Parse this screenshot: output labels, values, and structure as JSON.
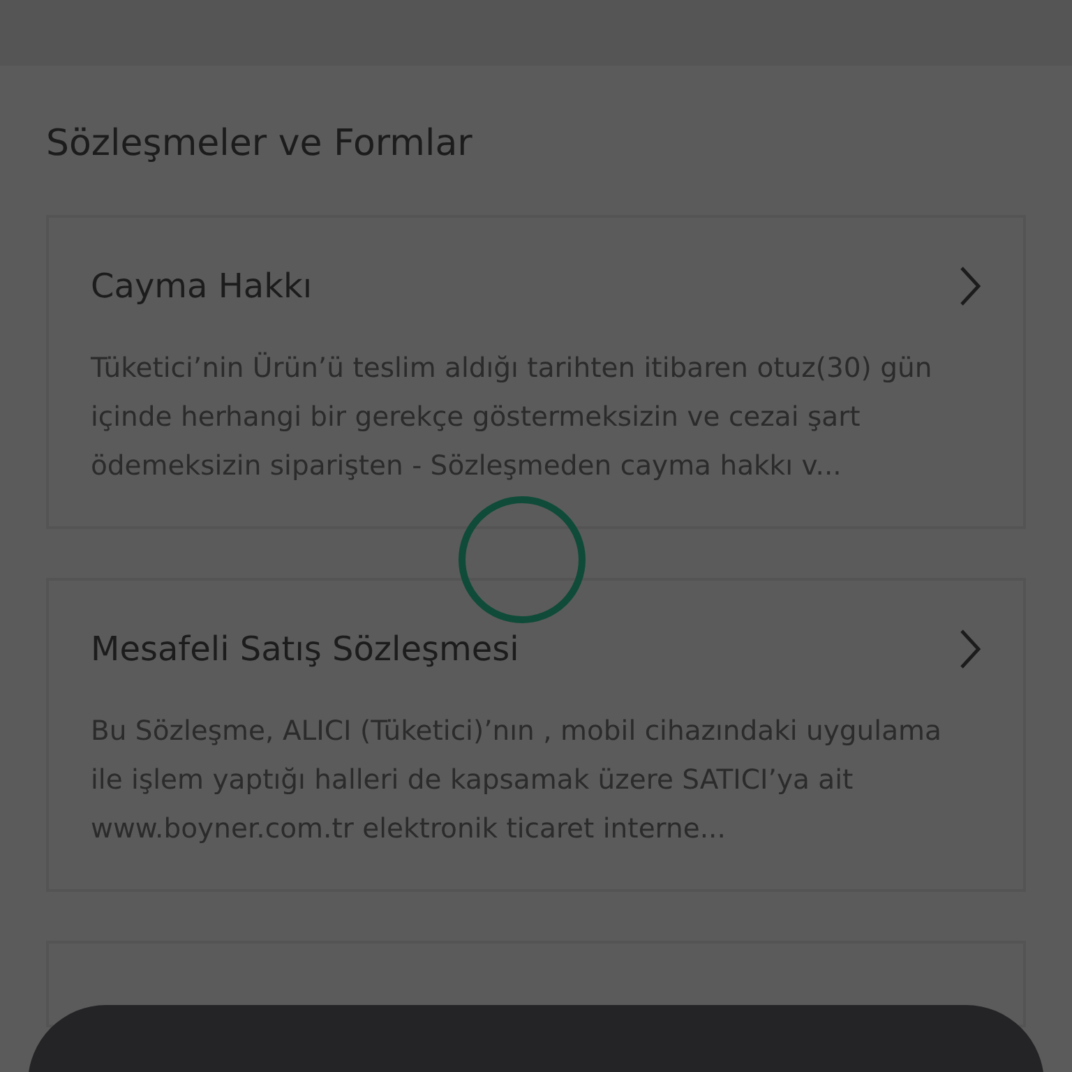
{
  "section": {
    "title": "Sözleşmeler ve Formlar"
  },
  "documents": [
    {
      "title": "Cayma Hakkı",
      "summary": "Tüketici’nin Ürün’ü teslim aldığı tarihten itibaren otuz(30) gün içinde herhangi bir gerekçe göstermeksizin ve cezai şart ödemeksizin siparişten - Sözleşmeden cayma hakkı v..."
    },
    {
      "title": "Mesafeli Satış Sözleşmesi",
      "summary": "Bu Sözleşme, ALICI (Tüketici)’nın , mobil cihazındaki uygulama ile işlem yaptığı halleri de kapsamak üzere SATICI’ya ait www.boyner.com.tr elektronik ticaret interne..."
    }
  ],
  "loading": true
}
